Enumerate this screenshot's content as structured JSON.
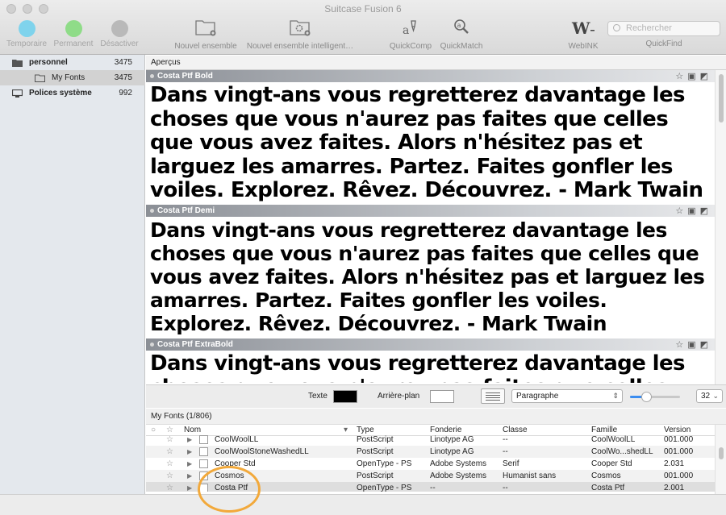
{
  "window": {
    "title": "Suitcase Fusion 6"
  },
  "toolbar": {
    "temporaire": "Temporaire",
    "permanent": "Permanent",
    "desactiver": "Désactiver",
    "nouvel_ensemble": "Nouvel ensemble",
    "nouvel_ensemble_intelligent": "Nouvel ensemble intelligent…",
    "quickcomp": "QuickComp",
    "quickmatch": "QuickMatch",
    "webink": "WebINK",
    "quickfind": "QuickFind",
    "search_placeholder": "Rechercher",
    "colors": {
      "temporaire": "#7fd3ec",
      "permanent": "#8fdc88",
      "desactiver": "#b9b9b9"
    }
  },
  "sidebar": {
    "items": [
      {
        "label": "personnel",
        "count": "3475"
      },
      {
        "label": "My Fonts",
        "count": "3475"
      },
      {
        "label": "Polices système",
        "count": "992"
      }
    ]
  },
  "previews": {
    "header": "Aperçus",
    "items": [
      {
        "font": "Costa Ptf Bold",
        "text": "Dans vingt-ans vous regretterez davantage les choses que vous n'aurez pas faites que celles que vous avez faites. Alors n'hésitez pas et larguez les amarres. Partez. Faites gonfler les voiles. Explorez. Rêvez. Découvrez. - Mark Twain"
      },
      {
        "font": "Costa Ptf Demi",
        "text": "Dans vingt-ans vous regretterez davantage les choses que vous n'aurez pas faites que celles que vous avez faites. Alors n'hésitez pas et larguez les amarres. Partez. Faites gonfler les voiles. Explorez. Rêvez. Découvrez. - Mark Twain"
      },
      {
        "font": "Costa Ptf ExtraBold",
        "text": "Dans vingt-ans vous regretterez davantage les choses que vous n'aurez pas faites que celles que"
      }
    ]
  },
  "controls": {
    "texte_label": "Texte",
    "arriere_plan_label": "Arrière-plan",
    "paragraph_select": "Paragraphe",
    "size_select": "32",
    "size_fraction": 0.25
  },
  "list": {
    "title": "My Fonts (1/806)",
    "columns": {
      "nom": "Nom",
      "type": "Type",
      "fonderie": "Fonderie",
      "classe": "Classe",
      "famille": "Famille",
      "version": "Version"
    },
    "rows": [
      {
        "nom": "CoolWoolLL",
        "type": "PostScript",
        "fonderie": "Linotype AG",
        "classe": "--",
        "famille": "CoolWoolLL",
        "version": "001.000"
      },
      {
        "nom": "CoolWoolStoneWashedLL",
        "type": "PostScript",
        "fonderie": "Linotype AG",
        "classe": "--",
        "famille": "CoolWo...shedLL",
        "version": "001.000"
      },
      {
        "nom": "Cooper Std",
        "type": "OpenType - PS",
        "fonderie": "Adobe Systems",
        "classe": "Serif",
        "famille": "Cooper Std",
        "version": "2.031"
      },
      {
        "nom": "Cosmos",
        "type": "PostScript",
        "fonderie": "Adobe Systems",
        "classe": "Humanist sans",
        "famille": "Cosmos",
        "version": "001.000"
      },
      {
        "nom": "Costa Ptf",
        "type": "OpenType - PS",
        "fonderie": "--",
        "classe": "--",
        "famille": "Costa Ptf",
        "version": "2.001"
      }
    ]
  }
}
